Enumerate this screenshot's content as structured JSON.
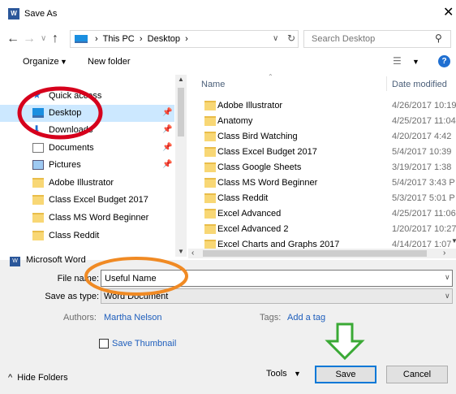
{
  "window": {
    "title": "Save As",
    "app_icon_text": "W",
    "close_glyph": "✕"
  },
  "address": {
    "path_text": " ›  This PC  ›  Desktop  ›",
    "search_placeholder": "Search Desktop"
  },
  "toolbar": {
    "organize_label": "Organize",
    "new_folder_label": "New folder",
    "help_label": "?"
  },
  "nav_pane": {
    "items": [
      {
        "label": "Quick access",
        "icon": "star-icon"
      },
      {
        "label": "Desktop",
        "icon": "desktop-icon",
        "selected": true
      },
      {
        "label": "Downloads",
        "icon": "download-icon"
      },
      {
        "label": "Documents",
        "icon": "documents-icon"
      },
      {
        "label": "Pictures",
        "icon": "pictures-icon"
      },
      {
        "label": "Adobe Illustrator",
        "icon": "folder-icon"
      },
      {
        "label": "Class Excel Budget 2017",
        "icon": "folder-icon"
      },
      {
        "label": "Class MS Word Beginner",
        "icon": "folder-icon"
      },
      {
        "label": "Class Reddit",
        "icon": "folder-icon"
      },
      {
        "label": "Microsoft Word",
        "icon": "word-icon"
      }
    ]
  },
  "file_list": {
    "columns": [
      "Name",
      "Date modified"
    ],
    "rows": [
      {
        "name": "Adobe Illustrator",
        "date": "4/26/2017 10:19"
      },
      {
        "name": "Anatomy",
        "date": "4/25/2017 11:04"
      },
      {
        "name": "Class Bird Watching",
        "date": "4/20/2017 4:42"
      },
      {
        "name": "Class Excel Budget 2017",
        "date": "5/4/2017 10:39"
      },
      {
        "name": "Class Google Sheets",
        "date": "3/19/2017 1:38"
      },
      {
        "name": "Class MS Word Beginner",
        "date": "5/4/2017 3:43 P"
      },
      {
        "name": "Class Reddit",
        "date": "5/3/2017 5:01 P"
      },
      {
        "name": "Excel Advanced",
        "date": "4/25/2017 11:06"
      },
      {
        "name": "Excel Advanced 2",
        "date": "1/20/2017 10:27"
      },
      {
        "name": "Excel Charts and Graphs 2017",
        "date": "4/14/2017 1:07"
      }
    ]
  },
  "form": {
    "filename_label": "File name:",
    "filename_value": "Useful Name",
    "savetype_label": "Save as type:",
    "savetype_value": "Word Document",
    "authors_label": "Authors:",
    "authors_value": "Martha Nelson",
    "tags_label": "Tags:",
    "tags_value": "Add a tag",
    "thumbnail_label": "Save Thumbnail"
  },
  "footer": {
    "hide_folders_label": "^  Hide Folders",
    "tools_label": "Tools",
    "save_label": "Save",
    "cancel_label": "Cancel"
  },
  "colors": {
    "selection": "#cce8ff",
    "save_border": "#0078d7",
    "annotation_red": "#d6001c",
    "annotation_orange": "#f08a24",
    "annotation_green": "#3aa935"
  }
}
